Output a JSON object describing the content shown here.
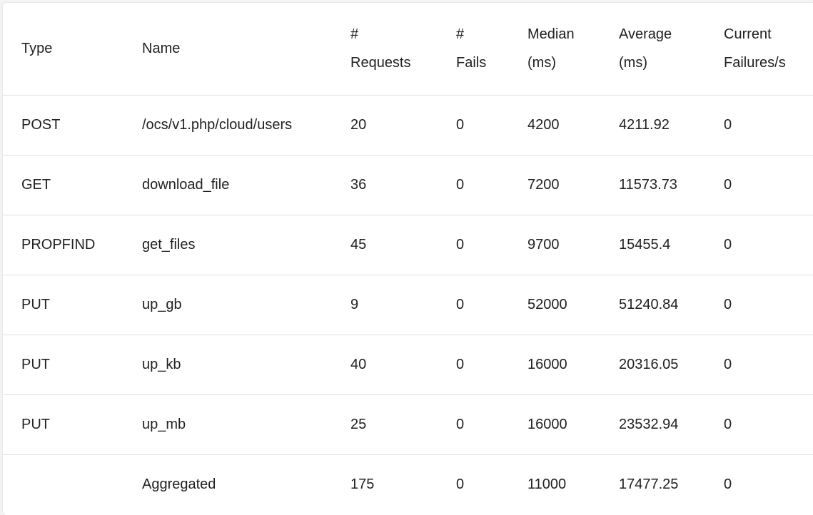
{
  "table": {
    "headers": [
      {
        "key": "type",
        "lines": [
          "Type"
        ]
      },
      {
        "key": "name",
        "lines": [
          "Name"
        ]
      },
      {
        "key": "requests",
        "lines": [
          "#",
          "Requests"
        ]
      },
      {
        "key": "fails",
        "lines": [
          "#",
          "Fails"
        ]
      },
      {
        "key": "median",
        "lines": [
          "Median",
          "(ms)"
        ]
      },
      {
        "key": "average",
        "lines": [
          "Average",
          "(ms)"
        ]
      },
      {
        "key": "current_failures",
        "lines": [
          "Current",
          "Failures/s"
        ]
      }
    ],
    "rows": [
      {
        "type": "POST",
        "name": "/ocs/v1.php/cloud/users",
        "requests": "20",
        "fails": "0",
        "median": "4200",
        "average": "4211.92",
        "current_failures": "0"
      },
      {
        "type": "GET",
        "name": "download_file",
        "requests": "36",
        "fails": "0",
        "median": "7200",
        "average": "11573.73",
        "current_failures": "0"
      },
      {
        "type": "PROPFIND",
        "name": "get_files",
        "requests": "45",
        "fails": "0",
        "median": "9700",
        "average": "15455.4",
        "current_failures": "0"
      },
      {
        "type": "PUT",
        "name": "up_gb",
        "requests": "9",
        "fails": "0",
        "median": "52000",
        "average": "51240.84",
        "current_failures": "0"
      },
      {
        "type": "PUT",
        "name": "up_kb",
        "requests": "40",
        "fails": "0",
        "median": "16000",
        "average": "20316.05",
        "current_failures": "0"
      },
      {
        "type": "PUT",
        "name": "up_mb",
        "requests": "25",
        "fails": "0",
        "median": "16000",
        "average": "23532.94",
        "current_failures": "0"
      },
      {
        "type": "",
        "name": "Aggregated",
        "requests": "175",
        "fails": "0",
        "median": "11000",
        "average": "17477.25",
        "current_failures": "0"
      }
    ]
  }
}
